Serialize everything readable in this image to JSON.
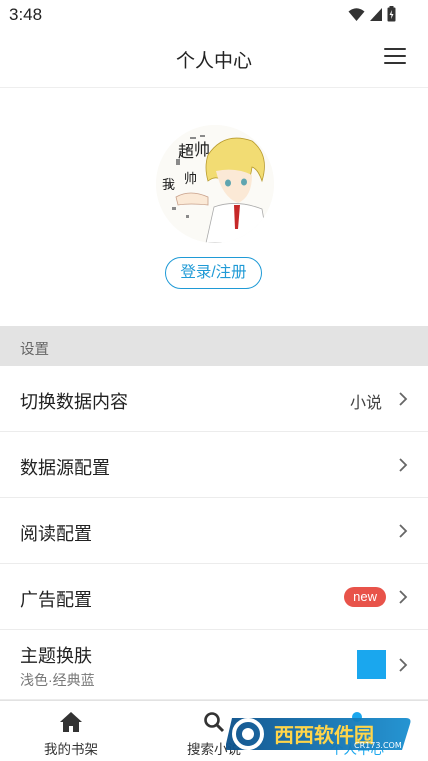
{
  "status_bar": {
    "time": "3:48"
  },
  "header": {
    "title": "个人中心"
  },
  "profile": {
    "avatar_text": "我超帅",
    "login_label": "登录/注册"
  },
  "settings": {
    "section_title": "设置",
    "rows": [
      {
        "label": "切换数据内容",
        "value": "小说"
      },
      {
        "label": "数据源配置"
      },
      {
        "label": "阅读配置"
      },
      {
        "label": "广告配置",
        "badge": "new"
      },
      {
        "label": "主题换肤",
        "sublabel": "浅色·经典蓝",
        "swatch_color": "#1AA7EE"
      }
    ]
  },
  "bottom_nav": [
    {
      "label": "我的书架",
      "icon": "home-icon"
    },
    {
      "label": "搜索小说",
      "icon": "search-icon"
    },
    {
      "label": "个人中心",
      "icon": "person-icon",
      "active": true
    }
  ],
  "watermark": {
    "text": "西西软件园",
    "subtext": "CR173.COM"
  },
  "colors": {
    "accent": "#1AA7EE",
    "badge": "#E8534A",
    "section_bg": "#E3E3E3"
  }
}
